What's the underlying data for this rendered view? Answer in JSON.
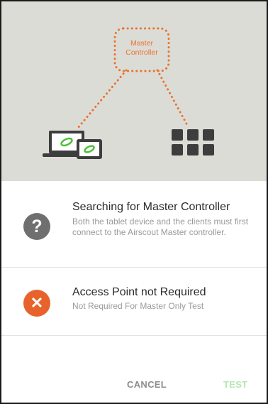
{
  "diagram": {
    "master_controller_line1": "Master",
    "master_controller_line2": "Controller"
  },
  "rows": [
    {
      "icon": "question-icon",
      "icon_glyph": "?",
      "icon_color": "#6f6f6f",
      "title": "Searching for Master Controller",
      "subtitle": "Both the tablet device and the clients must first connect to the Airscout Master controller."
    },
    {
      "icon": "error-x-icon",
      "icon_glyph": "✕",
      "icon_color": "#e8632b",
      "title": "Access Point not Required",
      "subtitle": "Not Required For Master Only Test"
    }
  ],
  "actions": {
    "cancel_label": "CANCEL",
    "test_label": "TEST"
  },
  "colors": {
    "accent_orange": "#e8722e",
    "test_disabled": "#b5e6b0",
    "hero_bg": "#dcdcd7"
  }
}
